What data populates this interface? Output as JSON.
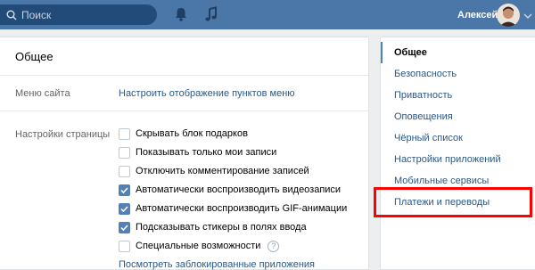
{
  "topbar": {
    "search_placeholder": "Поиск",
    "username": "Алексей"
  },
  "main": {
    "title": "Общее",
    "site_menu": {
      "label": "Меню сайта",
      "link": "Настроить отображение пунктов меню"
    },
    "page_settings": {
      "label": "Настройки страницы",
      "options": [
        {
          "label": "Скрывать блок подарков",
          "checked": false
        },
        {
          "label": "Показывать только мои записи",
          "checked": false
        },
        {
          "label": "Отключить комментирование записей",
          "checked": false
        },
        {
          "label": "Автоматически воспроизводить видеозаписи",
          "checked": true
        },
        {
          "label": "Автоматически воспроизводить GIF-анимации",
          "checked": true
        },
        {
          "label": "Подсказывать стикеры в полях ввода",
          "checked": true
        },
        {
          "label": "Специальные возможности",
          "checked": false
        }
      ],
      "blocked_apps_link": "Посмотреть заблокированные приложения"
    }
  },
  "menu": {
    "items": [
      {
        "label": "Общее",
        "active": true
      },
      {
        "label": "Безопасность",
        "active": false
      },
      {
        "label": "Приватность",
        "active": false
      },
      {
        "label": "Оповещения",
        "active": false
      },
      {
        "label": "Чёрный список",
        "active": false
      },
      {
        "label": "Настройки приложений",
        "active": false
      },
      {
        "label": "Мобильные сервисы",
        "active": false
      },
      {
        "label": "Платежи и переводы",
        "active": false
      }
    ]
  },
  "colors": {
    "header": "#4a76a8",
    "link": "#2a5885",
    "checkbox_checked": "#5181b8",
    "highlight": "#ff0000"
  },
  "icons": {
    "search": "search-icon",
    "bell": "bell-icon",
    "music": "music-note-icon",
    "checkmark": "checkmark-icon",
    "help": "question-icon"
  }
}
